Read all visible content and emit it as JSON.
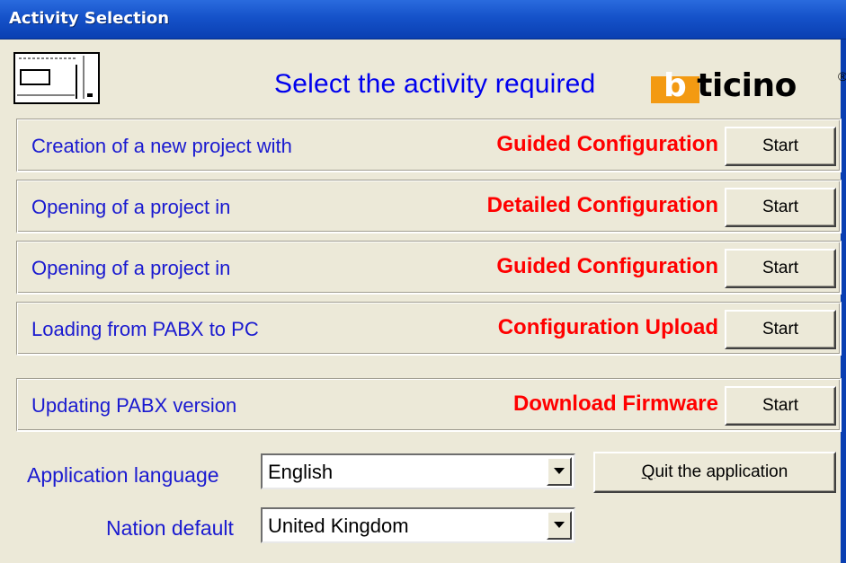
{
  "window": {
    "title": "Activity Selection"
  },
  "header": {
    "prompt": "Select the activity required",
    "logo_text_b": "b",
    "logo_text_rest": "ticino",
    "logo_reg": "®",
    "icon": "pabx-device-icon"
  },
  "activities": [
    {
      "description": "Creation of a new project with",
      "mode": "Guided Configuration",
      "button": "Start"
    },
    {
      "description": "Opening of a project in",
      "mode": "Detailed Configuration",
      "button": "Start"
    },
    {
      "description": "Opening of a project in",
      "mode": "Guided Configuration",
      "button": "Start"
    },
    {
      "description": "Loading from PABX to PC",
      "mode": "Configuration Upload",
      "button": "Start"
    },
    {
      "description": "Updating PABX version",
      "mode": "Download Firmware",
      "button": "Start"
    }
  ],
  "settings": {
    "language_label": "Application language",
    "language_value": "English",
    "nation_label": "Nation default",
    "nation_value": "United Kingdom"
  },
  "quit": {
    "mnemonic": "Q",
    "rest": "uit the application"
  },
  "colors": {
    "accent_blue": "#1a1ad0",
    "mode_red": "#ff0000",
    "logo_orange": "#f39a12",
    "titlebar": "#1552c9"
  }
}
